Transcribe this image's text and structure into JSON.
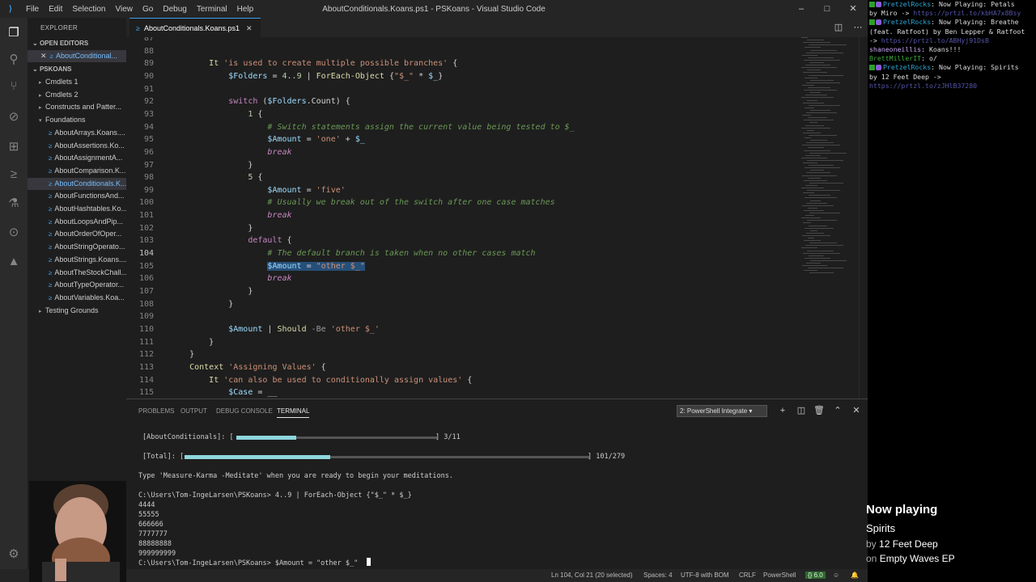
{
  "window": {
    "title": "AboutConditionals.Koans.ps1 - PSKoans - Visual Studio Code",
    "menu": [
      "File",
      "Edit",
      "Selection",
      "View",
      "Go",
      "Debug",
      "Terminal",
      "Help"
    ],
    "controls": {
      "minimize": "–",
      "maximize": "□",
      "close": "✕"
    }
  },
  "sidebar": {
    "explorer_label": "EXPLORER",
    "open_editors_label": "OPEN EDITORS",
    "open_editor_item": "AboutConditional...",
    "folder_label": "PSKOANS",
    "items": [
      {
        "label": "Cmdlets 1",
        "type": "folder"
      },
      {
        "label": "Cmdlets 2",
        "type": "folder"
      },
      {
        "label": "Constructs and Patter...",
        "type": "folder"
      },
      {
        "label": "Foundations",
        "type": "folder-open"
      },
      {
        "label": "AboutArrays.Koans....",
        "type": "file"
      },
      {
        "label": "AboutAssertions.Ko...",
        "type": "file"
      },
      {
        "label": "AboutAssignmentA...",
        "type": "file"
      },
      {
        "label": "AboutComparison.K...",
        "type": "file"
      },
      {
        "label": "AboutConditionals.K...",
        "type": "file",
        "active": true
      },
      {
        "label": "AboutFunctionsAnd...",
        "type": "file"
      },
      {
        "label": "AboutHashtables.Ko...",
        "type": "file"
      },
      {
        "label": "AboutLoopsAndPip...",
        "type": "file"
      },
      {
        "label": "AboutOrderOfOper...",
        "type": "file"
      },
      {
        "label": "AboutStringOperato...",
        "type": "file"
      },
      {
        "label": "AboutStrings.Koans....",
        "type": "file"
      },
      {
        "label": "AboutTheStockChall...",
        "type": "file"
      },
      {
        "label": "AboutTypeOperator...",
        "type": "file"
      },
      {
        "label": "AboutVariables.Koa...",
        "type": "file"
      },
      {
        "label": "Testing Grounds",
        "type": "folder"
      }
    ]
  },
  "tab": {
    "label": "AboutConditionals.Koans.ps1",
    "close": "✕"
  },
  "editor": {
    "colors": {
      "keyword": "#c586c0",
      "string": "#ce9178",
      "variable": "#9cdcfe",
      "comment": "#6a9955",
      "function": "#dcdcaa",
      "number": "#b5cea8",
      "operator": "#d4d4d4"
    },
    "lines": [
      {
        "n": "87",
        "text": ""
      },
      {
        "n": "88",
        "text": ""
      },
      {
        "n": "89",
        "text": "        It 'is used to create multiple possible branches' {"
      },
      {
        "n": "90",
        "text": "            $Folders = 4..9 | ForEach-Object {\"$_\" * $_}"
      },
      {
        "n": "91",
        "text": ""
      },
      {
        "n": "92",
        "text": "            switch ($Folders.Count) {"
      },
      {
        "n": "93",
        "text": "                1 {"
      },
      {
        "n": "94",
        "text": "                    # Switch statements assign the current value being tested to $_"
      },
      {
        "n": "95",
        "text": "                    $Amount = 'one' + $_"
      },
      {
        "n": "96",
        "text": "                    break"
      },
      {
        "n": "97",
        "text": "                }"
      },
      {
        "n": "98",
        "text": "                5 {"
      },
      {
        "n": "99",
        "text": "                    $Amount = 'five'"
      },
      {
        "n": "100",
        "text": "                    # Usually we break out of the switch after one case matches"
      },
      {
        "n": "101",
        "text": "                    break"
      },
      {
        "n": "102",
        "text": "                }"
      },
      {
        "n": "103",
        "text": "                default {"
      },
      {
        "n": "104",
        "text": "                    # The default branch is taken when no other cases match"
      },
      {
        "n": "105",
        "text": "                    $Amount = \"other $_\""
      },
      {
        "n": "106",
        "text": "                    break"
      },
      {
        "n": "107",
        "text": "                }"
      },
      {
        "n": "108",
        "text": "            }"
      },
      {
        "n": "109",
        "text": ""
      },
      {
        "n": "110",
        "text": "            $Amount | Should -Be 'other $_'"
      },
      {
        "n": "111",
        "text": "        }"
      },
      {
        "n": "112",
        "text": "    }"
      },
      {
        "n": "113",
        "text": "    Context 'Assigning Values' {"
      },
      {
        "n": "114",
        "text": "        It 'can also be used to conditionally assign values' {"
      },
      {
        "n": "115",
        "text": "            $Case = __"
      }
    ]
  },
  "panel": {
    "tabs": [
      "PROBLEMS",
      "OUTPUT",
      "DEBUG CONSOLE",
      "TERMINAL"
    ],
    "terminal_select": "2: PowerShell Integrate",
    "progress": [
      {
        "label": "[AboutConditionals]: [",
        "end": "] 3/11",
        "fraction": 0.3
      },
      {
        "label": "[Total]: [",
        "end": "] 101/279",
        "fraction": 0.36
      }
    ],
    "lines": [
      "Type 'Measure-Karma -Meditate' when you are ready to begin your meditations.",
      "",
      "C:\\Users\\Tom-IngeLarsen\\PSKoans> 4..9 | ForEach-Object {\"$_\" * $_}",
      "4444",
      "55555",
      "666666",
      "7777777",
      "88888888",
      "999999999",
      "C:\\Users\\Tom-IngeLarsen\\PSKoans> $Amount = \"other $_\""
    ]
  },
  "statusbar": {
    "position": "Ln 104, Col 21 (20 selected)",
    "spaces": "Spaces: 4",
    "encoding": "UTF-8 with BOM",
    "eol": "CRLF",
    "language": "PowerShell",
    "ps_version": "6.0"
  },
  "chat": {
    "lines": [
      {
        "user": "PretzelRocks",
        "text": ": Now Playing: Petals"
      },
      {
        "cont": "by Miro -> ",
        "link": "https://prtzl.to/kbHA7x8Bsy"
      },
      {
        "user": "PretzelRocks",
        "text": ": Now Playing: Breathe"
      },
      {
        "cont": "(feat. Ratfoot) by Ben Lepper & Ratfoot"
      },
      {
        "cont": "-> ",
        "link": "https://prtzl.to/ABHyj91DsB"
      },
      {
        "user2": "shaneoneillis",
        "text": ": Koans!!!"
      },
      {
        "user3": "BrettMillerIT",
        "text": ": o/"
      },
      {
        "user": "PretzelRocks",
        "text": ": Now Playing: Spirits"
      },
      {
        "cont": "by 12 Feet Deep ->"
      },
      {
        "cont": "",
        "link": "https://prtzl.to/zJHlB37280"
      }
    ]
  },
  "now_playing": {
    "heading": "Now playing",
    "track": "Spirits",
    "artist_prefix": "by ",
    "artist": "12 Feet Deep",
    "album_prefix": "on ",
    "album": "Empty Waves EP"
  }
}
